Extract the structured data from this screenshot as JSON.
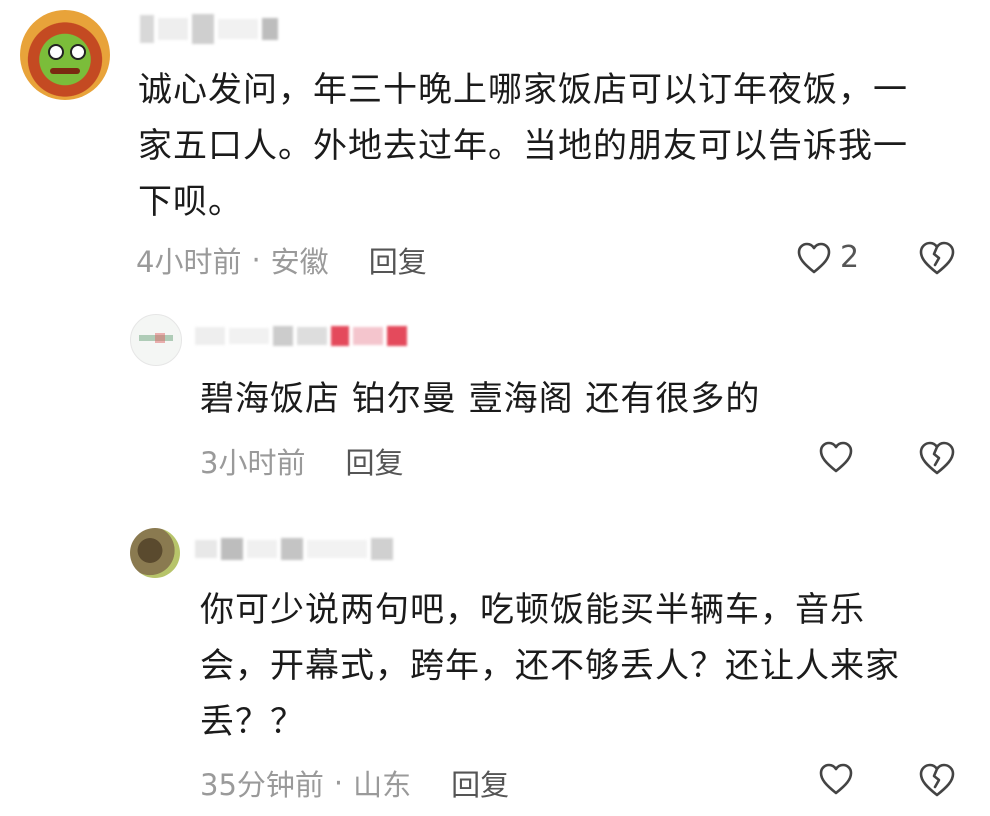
{
  "comments": [
    {
      "text_lines": [
        "诚心发问，年三十晚上哪家饭店可以订年夜饭，一",
        "家五口人。外地去过年。当地的朋友可以告诉我一",
        "下呗。"
      ],
      "time": "4小时前",
      "location": "安徽",
      "reply_label": "回复",
      "like_count": "2"
    },
    {
      "text_lines": [
        "碧海饭店 铂尔曼 壹海阁 还有很多的"
      ],
      "time": "3小时前",
      "reply_label": "回复"
    },
    {
      "text_lines": [
        "你可少说两句吧，吃顿饭能买半辆车，音乐",
        "会，开幕式，跨年，还不够丢人？还让人来家",
        "丢？？"
      ],
      "time": "35分钟前",
      "location": "山东",
      "reply_label": "回复"
    }
  ],
  "separator": "·",
  "icons": {
    "like": "heart-outline-icon",
    "dislike": "broken-heart-icon"
  },
  "colors": {
    "text": "#1b1b1b",
    "meta": "#9a9a9a",
    "reply": "#555555",
    "icon": "#444444"
  }
}
